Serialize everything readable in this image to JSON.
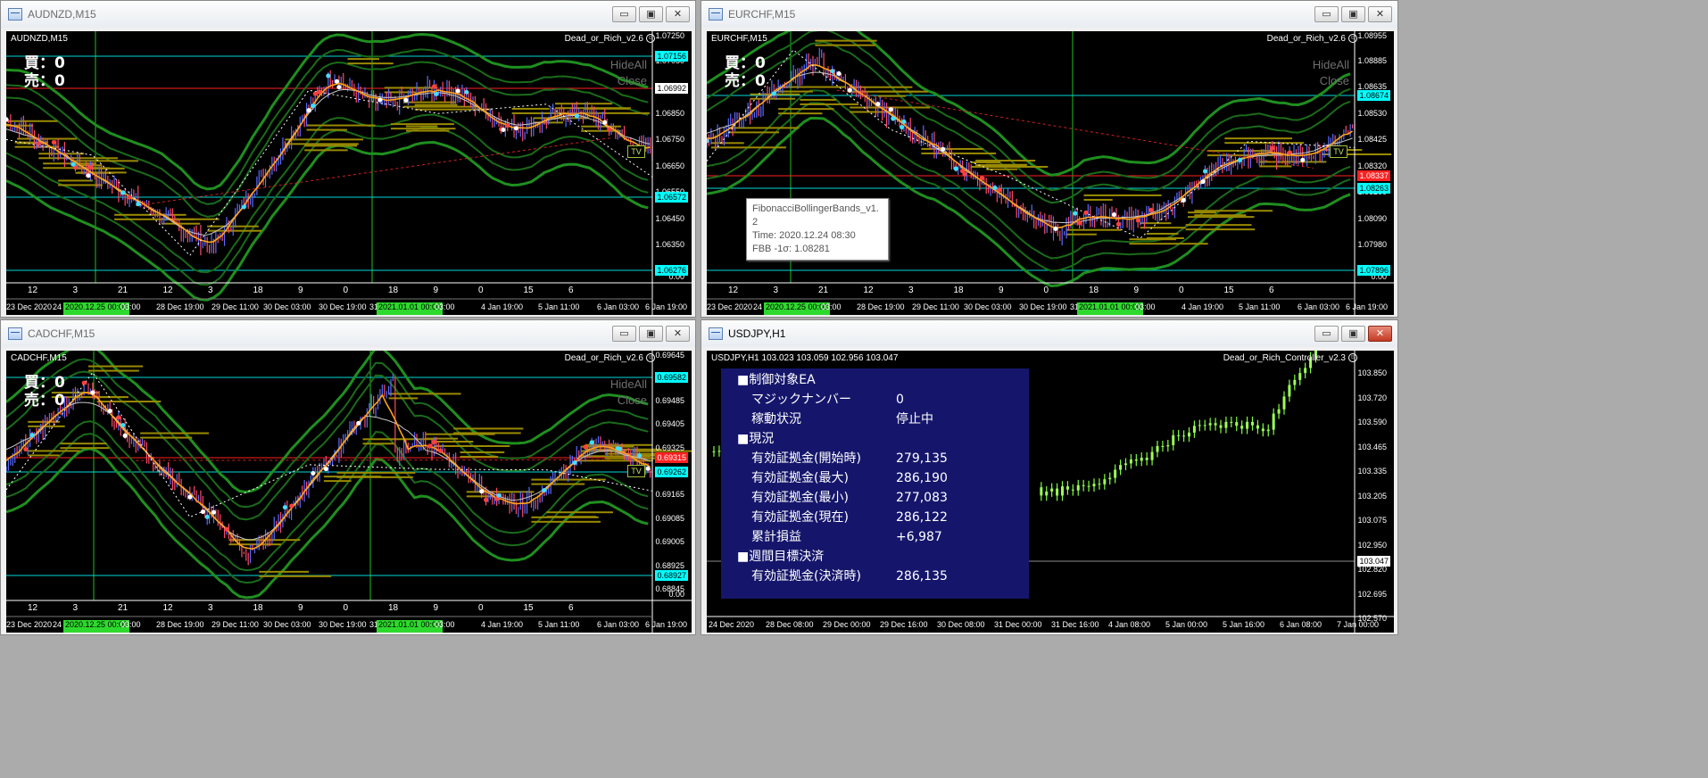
{
  "windows": {
    "audnzd": {
      "title": "AUDNZD,M15",
      "symbol": "AUDNZD,M15",
      "ea": "Dead_or_Rich_v2.6",
      "buy": "買：0",
      "sell": "売：0",
      "hideall": "HideAll",
      "close": "Close",
      "tv": "TV",
      "price_axis": [
        "1.07250",
        "1.07050",
        "1.06950",
        "1.06850",
        "1.06750",
        "1.06650",
        "1.06550",
        "1.06450",
        "1.06350",
        "1.06250",
        "0.00"
      ],
      "price_labels": [
        {
          "text": "1.07156",
          "color": "#00ffff"
        },
        {
          "text": "1.06992",
          "color": "#ffffff"
        },
        {
          "text": "1.06572",
          "color": "#00ffff"
        },
        {
          "text": "1.06276",
          "color": "#00ffff"
        }
      ],
      "time_numbers": [
        "12",
        "3",
        "21",
        "12",
        "3",
        "18",
        "9",
        "0",
        "18",
        "9",
        "0",
        "15",
        "6"
      ],
      "time_axis": [
        "23 Dec 2020",
        "24",
        "2020.12.25 00:00",
        "03:00",
        "28 Dec 19:00",
        "29 Dec 11:00",
        "30 Dec 03:00",
        "30 Dec 19:00",
        "31",
        "2021.01.01 00:00",
        "03:00",
        "4 Jan 19:00",
        "5 Jan 11:00",
        "6 Jan 03:00",
        "6 Jan 19:00"
      ]
    },
    "eurchf": {
      "title": "EURCHF,M15",
      "symbol": "EURCHF,M15",
      "ea": "Dead_or_Rich_v2.6",
      "buy": "買：0",
      "sell": "売：0",
      "hideall": "HideAll",
      "close": "Close",
      "tv": "TV",
      "price_axis": [
        "1.08955",
        "1.08885",
        "1.08635",
        "1.08530",
        "1.08425",
        "1.08320",
        "1.08200",
        "1.08090",
        "1.07980",
        "1.07870",
        "0.00"
      ],
      "price_labels": [
        {
          "text": "1.08674",
          "color": "#00ffff"
        },
        {
          "text": "1.08337",
          "color": "#ff2020"
        },
        {
          "text": "1.08263",
          "color": "#00ffff"
        },
        {
          "text": "1.07896",
          "color": "#00ffff"
        }
      ],
      "tooltip": [
        "FibonacciBollingerBands_v1.",
        "2",
        "Time: 2020.12.24 08:30",
        "FBB -1σ: 1.08281"
      ],
      "time_numbers": [
        "12",
        "3",
        "21",
        "12",
        "3",
        "18",
        "9",
        "0",
        "18",
        "9",
        "0",
        "15",
        "6"
      ],
      "time_axis": [
        "23 Dec 2020",
        "24",
        "2020.12.25 00:00",
        "03:00",
        "28 Dec 19:00",
        "29 Dec 11:00",
        "30 Dec 03:00",
        "30 Dec 19:00",
        "31",
        "2021.01.01 00:00",
        "03:00",
        "4 Jan 19:00",
        "5 Jan 11:00",
        "6 Jan 03:00",
        "6 Jan 19:00"
      ]
    },
    "cadchf": {
      "title": "CADCHF,M15",
      "symbol": "CADCHF,M15",
      "ea": "Dead_or_Rich_v2.6",
      "buy": "買：0",
      "sell": "売：0",
      "hideall": "HideAll",
      "close": "Close",
      "tv": "TV",
      "price_axis": [
        "0.69645",
        "0.69565",
        "0.69485",
        "0.69405",
        "0.69325",
        "0.69245",
        "0.69165",
        "0.69085",
        "0.69005",
        "0.68925",
        "0.68845",
        "0.00"
      ],
      "price_labels": [
        {
          "text": "0.69582",
          "color": "#00ffff"
        },
        {
          "text": "0.69315",
          "color": "#ff2020"
        },
        {
          "text": "0.69262",
          "color": "#00ffff"
        },
        {
          "text": "0.68927",
          "color": "#00ffff"
        }
      ],
      "time_numbers": [
        "12",
        "3",
        "21",
        "12",
        "3",
        "18",
        "9",
        "0",
        "18",
        "9",
        "0",
        "15",
        "6"
      ],
      "time_axis": [
        "23 Dec 2020",
        "24",
        "2020.12.25 00:00",
        "03:00",
        "28 Dec 19:00",
        "29 Dec 11:00",
        "30 Dec 03:00",
        "30 Dec 19:00",
        "31",
        "2021.01.01 00:00",
        "03:00",
        "4 Jan 19:00",
        "5 Jan 11:00",
        "6 Jan 03:00",
        "6 Jan 19:00"
      ]
    },
    "usdjpy": {
      "title": "USDJPY,H1",
      "symbol": "USDJPY,H1  103.023 103.059 102.956 103.047",
      "ea": "Dead_or_Rich_Controller_v2.3",
      "current_price": "103.047",
      "price_axis": [
        "103.850",
        "103.720",
        "103.590",
        "103.465",
        "103.335",
        "103.205",
        "103.075",
        "102.950",
        "102.820",
        "102.695",
        "102.570"
      ],
      "time_axis": [
        "24 Dec 2020",
        "28 Dec 08:00",
        "29 Dec 00:00",
        "29 Dec 16:00",
        "30 Dec 08:00",
        "31 Dec 00:00",
        "31 Dec 16:00",
        "4 Jan 08:00",
        "5 Jan 00:00",
        "5 Jan 16:00",
        "6 Jan 08:00",
        "7 Jan 00:00"
      ],
      "panel": [
        {
          "k": "■制御対象EA",
          "v": "",
          "head": true
        },
        {
          "k": "マジックナンバー",
          "v": "0"
        },
        {
          "k": "稼動状況",
          "v": "停止中"
        },
        {
          "k": "■現況",
          "v": "",
          "head": true
        },
        {
          "k": "有効証拠金(開始時)",
          "v": "279,135"
        },
        {
          "k": "有効証拠金(最大)",
          "v": "286,190"
        },
        {
          "k": "有効証拠金(最小)",
          "v": "277,083"
        },
        {
          "k": "有効証拠金(現在)",
          "v": "286,122"
        },
        {
          "k": "累計損益",
          "v": "+6,987"
        },
        {
          "k": "■週間目標決済",
          "v": "",
          "head": true
        },
        {
          "k": "有効証拠金(決済時)",
          "v": "286,135"
        }
      ]
    }
  },
  "window_buttons": {
    "minimize": "▭",
    "maximize": "▣",
    "close": "✕"
  },
  "colors": {
    "chart_bg": "#000000",
    "panel_bg": "#15166b",
    "cyan": "#00ffff",
    "red": "#ff0000",
    "orange": "#ffa500",
    "band": "#1f7a1f",
    "gold": "#b8a000",
    "jpy_candle": "#7fff3a"
  }
}
